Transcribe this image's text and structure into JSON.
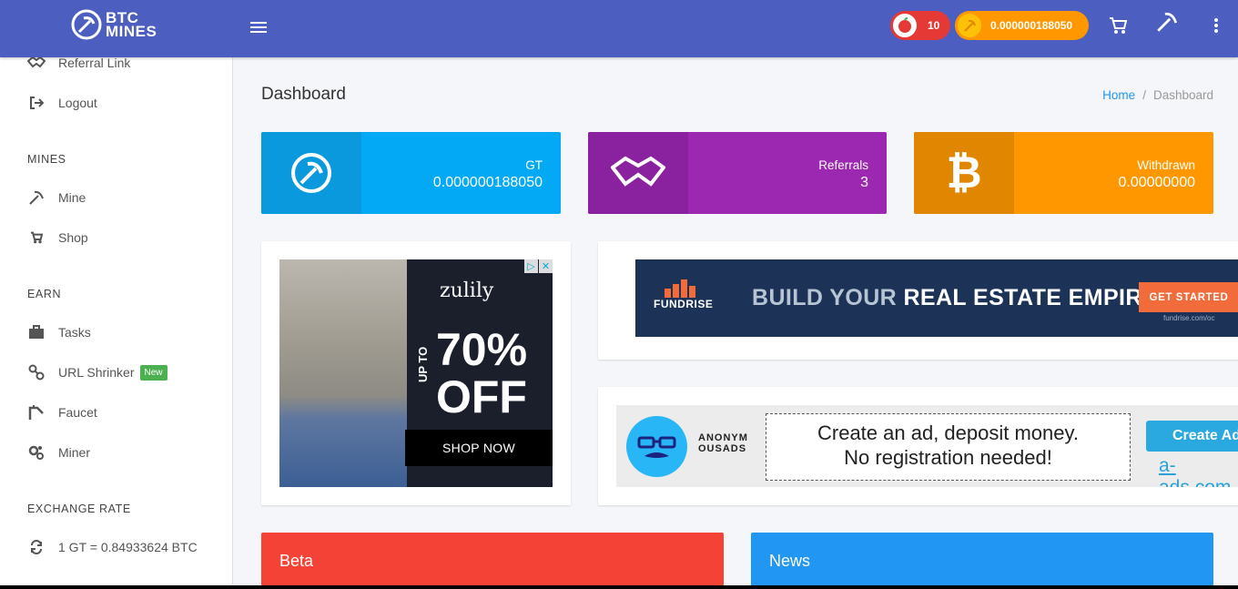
{
  "brand": {
    "line1": "BTC",
    "line2": "MINES"
  },
  "topbar": {
    "energy_value": "10",
    "balance_value": "0.000000188050"
  },
  "sidebar": {
    "items_top": [
      {
        "label": "Referral Link",
        "icon": "handshake-icon"
      },
      {
        "label": "Logout",
        "icon": "logout-icon"
      }
    ],
    "section_mines": "MINES",
    "mines_items": [
      {
        "label": "Mine",
        "icon": "pickaxe-icon"
      },
      {
        "label": "Shop",
        "icon": "cart-icon"
      }
    ],
    "section_earn": "EARN",
    "earn_items": [
      {
        "label": "Tasks",
        "icon": "briefcase-icon"
      },
      {
        "label": "URL Shrinker",
        "icon": "link-icon",
        "badge": "New"
      },
      {
        "label": "Faucet",
        "icon": "faucet-icon"
      },
      {
        "label": "Miner",
        "icon": "gears-icon"
      }
    ],
    "section_rate": "EXCHANGE RATE",
    "rate_text": "1 GT = 0.84933624 BTC"
  },
  "page": {
    "title": "Dashboard",
    "breadcrumb": {
      "home": "Home",
      "sep": "/",
      "current": "Dashboard"
    }
  },
  "stats": {
    "gt": {
      "label": "GT",
      "value": "0.000000188050"
    },
    "referrals": {
      "label": "Referrals",
      "value": "3"
    },
    "withdrawn": {
      "label": "Withdrawn",
      "value": "0.00000000"
    }
  },
  "ads": {
    "zulily": {
      "brand": "zulily",
      "upto": "UP TO",
      "big1": "70%",
      "big2": "OFF",
      "cta": "SHOP NOW"
    },
    "fundrise": {
      "brand": "FUNDRISE",
      "headline_a": "BUILD YOUR ",
      "headline_b": "REAL ESTATE EMPIRE.",
      "cta": "GET STARTED",
      "url": "fundrise.com/oc"
    },
    "aads": {
      "brand_l1": "ANONYM",
      "brand_l2": "OUSADS",
      "line1": "Create an ad, deposit money.",
      "line2": "No registration needed!",
      "cta": "Create Ad",
      "url": "a-ads.com"
    }
  },
  "panels": {
    "beta": "Beta",
    "news": "News"
  },
  "colors": {
    "topbar": "#4d5ec1",
    "gt": "#03a9f4",
    "referrals": "#9c27b0",
    "withdrawn": "#ff9800",
    "beta": "#f44336",
    "news": "#2196f3"
  }
}
